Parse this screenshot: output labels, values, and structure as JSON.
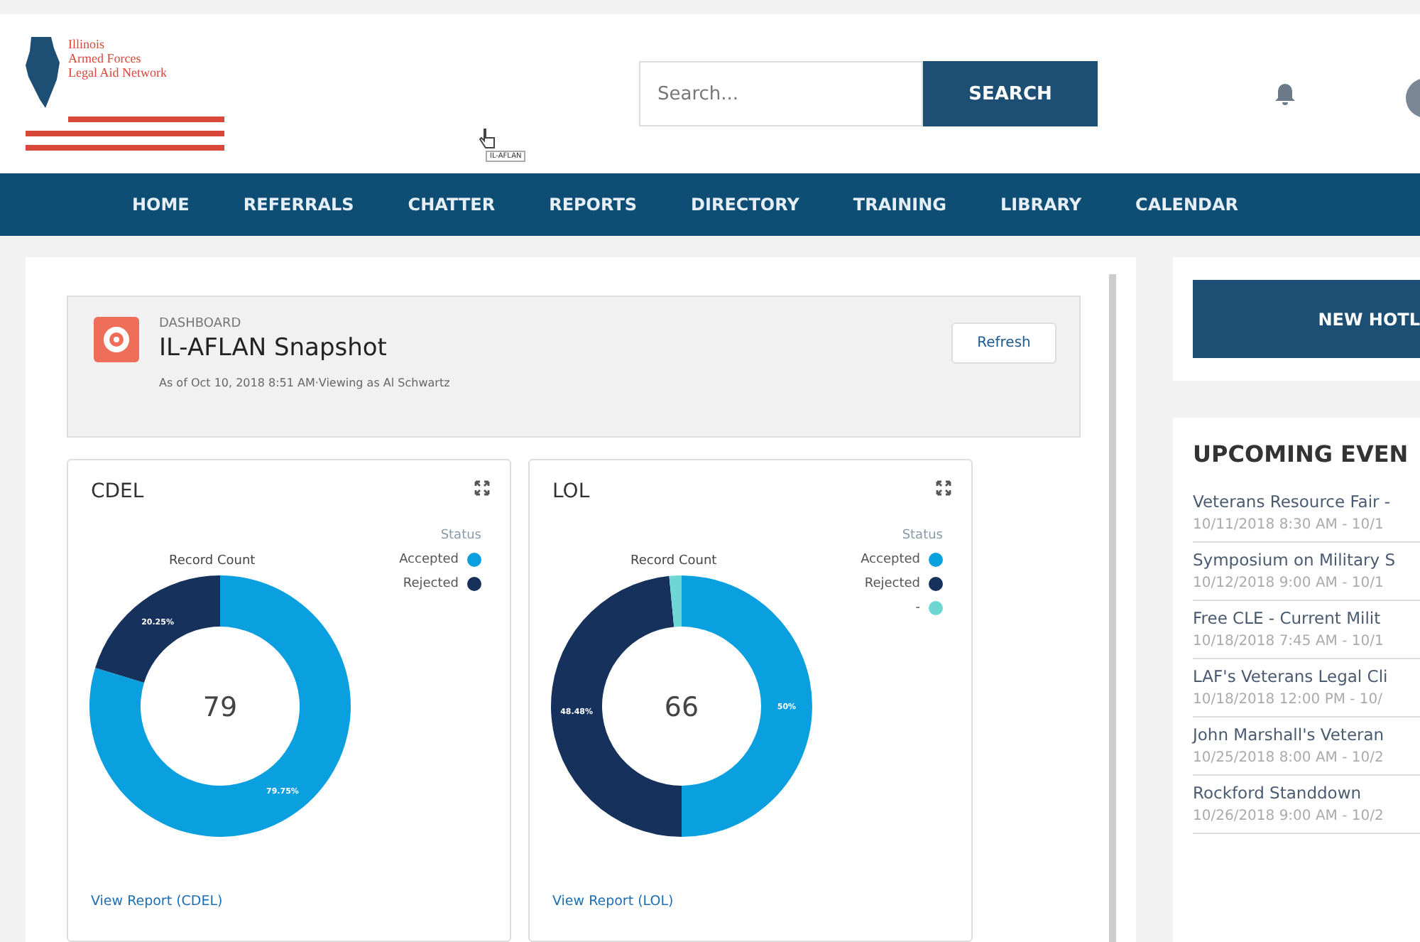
{
  "logo": {
    "lines": [
      "Illinois",
      "Armed Forces",
      "Legal Aid Network"
    ]
  },
  "search": {
    "placeholder": "Search...",
    "button": "SEARCH"
  },
  "cursor_tooltip": "IL-AFLAN",
  "nav": [
    "HOME",
    "REFERRALS",
    "CHATTER",
    "REPORTS",
    "DIRECTORY",
    "TRAINING",
    "LIBRARY",
    "CALENDAR"
  ],
  "dashboard": {
    "label": "DASHBOARD",
    "title": "IL-AFLAN Snapshot",
    "subtitle": "As of Oct 10, 2018 8:51 AM·Viewing as Al Schwartz",
    "refresh": "Refresh"
  },
  "widgets": [
    {
      "title": "CDEL",
      "center": "79",
      "link": "View Report (CDEL)",
      "chart_data": {
        "type": "donut",
        "title": "Record Count",
        "categories": [
          "Accepted",
          "Rejected"
        ],
        "series": [
          {
            "name": "Status",
            "values": [
              79.75,
              20.25
            ]
          }
        ],
        "colors": [
          "#0a9fdf",
          "#16325c"
        ],
        "value_labels": [
          "79.75%",
          "20.25%"
        ]
      }
    },
    {
      "title": "LOL",
      "center": "66",
      "link": "View Report (LOL)",
      "chart_data": {
        "type": "donut",
        "title": "Record Count",
        "categories": [
          "Accepted",
          "Rejected",
          "-"
        ],
        "series": [
          {
            "name": "Status",
            "values": [
              50,
              48.48,
              1.52
            ]
          }
        ],
        "colors": [
          "#0a9fdf",
          "#16325c",
          "#6fd6d6"
        ],
        "value_labels": [
          "50%",
          "48.48%",
          null
        ]
      }
    }
  ],
  "hotline_button": "NEW HOTL",
  "events": {
    "title": "UPCOMING EVEN",
    "items": [
      {
        "name": "Veterans Resource Fair -",
        "time": "10/11/2018 8:30 AM - 10/1"
      },
      {
        "name": "Symposium on Military S",
        "time": "10/12/2018 9:00 AM - 10/1"
      },
      {
        "name": "Free CLE - Current Milit",
        "time": "10/18/2018 7:45 AM - 10/1"
      },
      {
        "name": "LAF's Veterans Legal Cli",
        "time": "10/18/2018 12:00 PM - 10/"
      },
      {
        "name": "John Marshall's Veteran",
        "time": "10/25/2018 8:00 AM - 10/2"
      },
      {
        "name": "Rockford Standdown",
        "time": "10/26/2018 9:00 AM - 10/2"
      }
    ]
  }
}
